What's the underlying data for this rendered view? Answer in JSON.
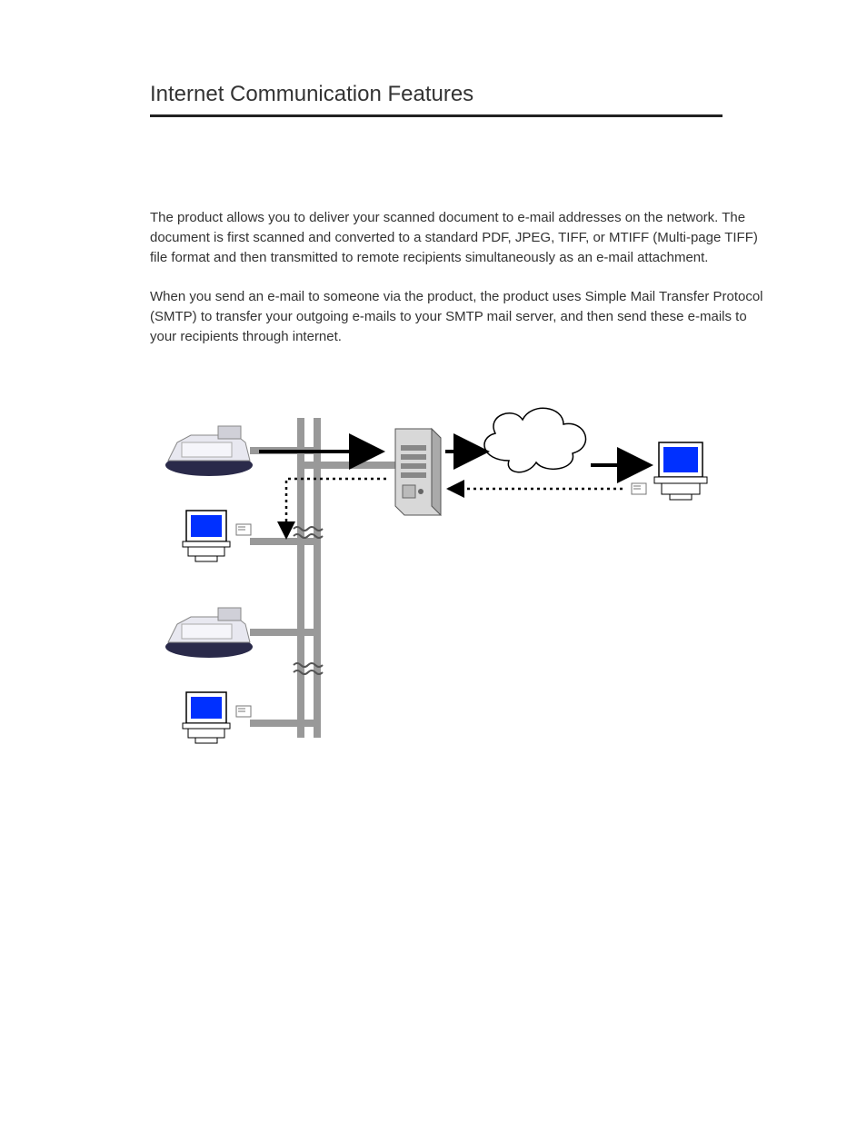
{
  "title": "Internet Communication Features",
  "para1": "The product allows you to deliver your scanned document to e-mail addresses on the network. The document is first scanned and converted to a standard PDF, JPEG, TIFF, or MTIFF (Multi-page TIFF) file format and then transmitted to remote recipients simultaneously as an e-mail attachment.",
  "para2": "When you send an e-mail to someone via the product, the product uses Simple Mail Transfer Protocol (SMTP) to transfer your outgoing e-mails to your SMTP mail server, and then send these e-mails to your recipients through internet.",
  "diagram": {
    "nodes": [
      "scanner-1",
      "pc-local-1",
      "scanner-2",
      "pc-local-2",
      "server",
      "cloud",
      "pc-remote"
    ],
    "arrows": [
      {
        "from": "scanner-1",
        "to": "server",
        "style": "solid"
      },
      {
        "from": "server",
        "to": "cloud",
        "style": "solid"
      },
      {
        "from": "cloud",
        "to": "pc-remote",
        "style": "solid"
      },
      {
        "from": "pc-remote",
        "to": "server",
        "style": "dotted"
      },
      {
        "from": "server",
        "to": "pc-local-1",
        "style": "dotted"
      }
    ],
    "bus_breaks": 2
  }
}
